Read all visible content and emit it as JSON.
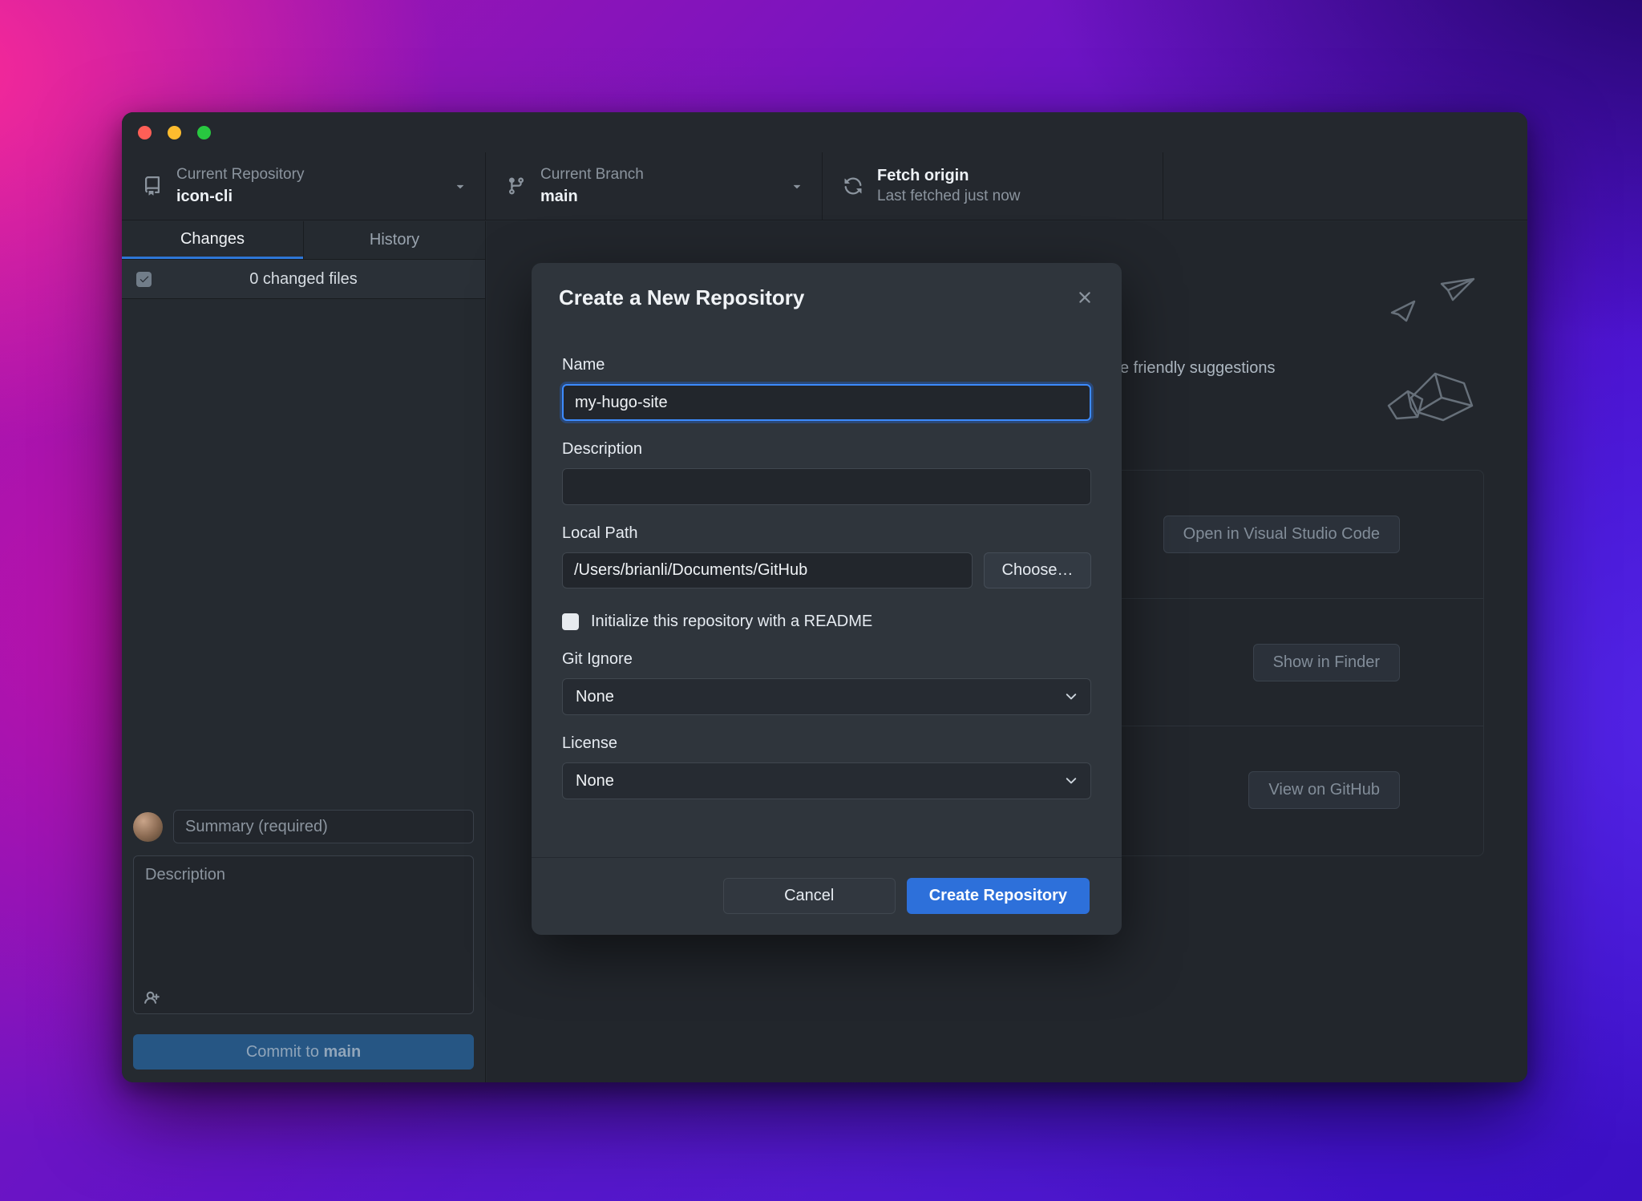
{
  "colors": {
    "accent_blue": "#2d70da",
    "focus_ring": "#3d8bfd",
    "active_tab_underline": "#2d76d6",
    "window_bg": "#252a30",
    "modal_bg": "#2f353c",
    "traffic_red": "#ff5f57",
    "traffic_yellow": "#febc2e",
    "traffic_green": "#28c840"
  },
  "toolbar": {
    "repository": {
      "label": "Current Repository",
      "value": "icon-cli"
    },
    "branch": {
      "label": "Current Branch",
      "value": "main"
    },
    "fetch": {
      "title": "Fetch origin",
      "subtitle": "Last fetched just now"
    }
  },
  "sidebar": {
    "tabs": {
      "changes": "Changes",
      "history": "History"
    },
    "changed_files": "0 changed files",
    "summary_placeholder": "Summary (required)",
    "description_placeholder": "Description",
    "commit": {
      "prefix": "Commit to ",
      "branch": "main"
    }
  },
  "content": {
    "suggestions_text": "e friendly suggestions",
    "open_vscode": "Open in Visual Studio Code",
    "show_finder": "Show in Finder",
    "view_github": "View on GitHub"
  },
  "modal": {
    "title": "Create a New Repository",
    "name": {
      "label": "Name",
      "value": "my-hugo-site"
    },
    "description": {
      "label": "Description",
      "value": ""
    },
    "local_path": {
      "label": "Local Path",
      "value": "/Users/brianli/Documents/GitHub",
      "choose": "Choose…"
    },
    "readme": "Initialize this repository with a README",
    "git_ignore": {
      "label": "Git Ignore",
      "value": "None"
    },
    "license": {
      "label": "License",
      "value": "None"
    },
    "cancel": "Cancel",
    "create": "Create Repository"
  }
}
